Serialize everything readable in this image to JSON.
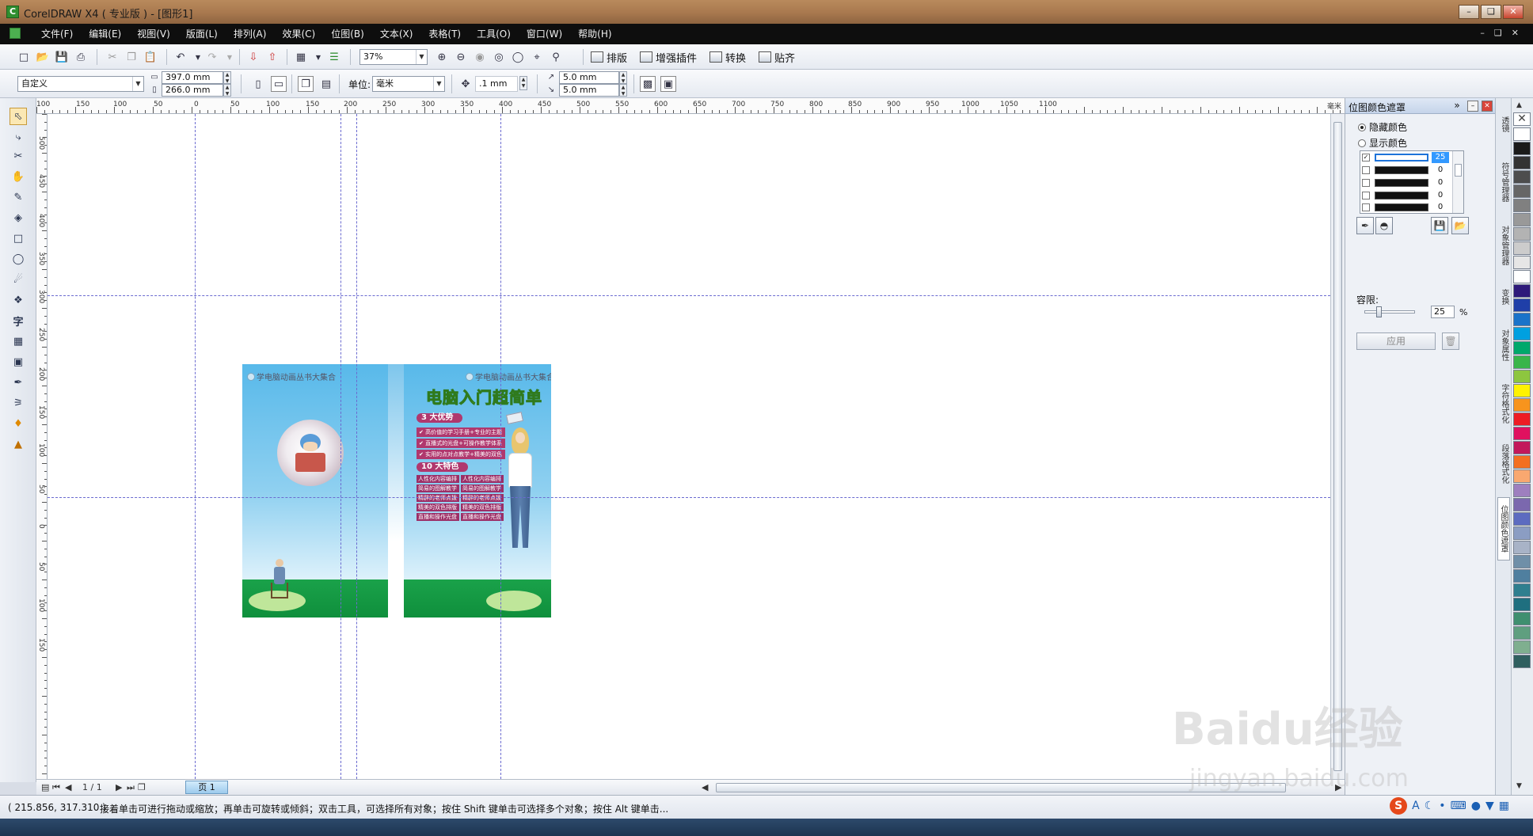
{
  "window": {
    "title": "CorelDRAW X4 ( 专业版 ) - [图形1]",
    "buttons": [
      "–",
      "❑",
      "✕"
    ]
  },
  "menubar": {
    "items": [
      "文件(F)",
      "编辑(E)",
      "视图(V)",
      "版面(L)",
      "排列(A)",
      "效果(C)",
      "位图(B)",
      "文本(X)",
      "表格(T)",
      "工具(O)",
      "窗口(W)",
      "帮助(H)"
    ],
    "doc_buttons": [
      "–",
      "❑",
      "✕"
    ]
  },
  "toolbar1": {
    "zoom": "37%",
    "plugins": [
      "排版",
      "增强插件",
      "转换",
      "贴齐"
    ]
  },
  "toolbar2": {
    "preset": "自定义",
    "width": "397.0 mm",
    "height": "266.0 mm",
    "unit_label": "单位:",
    "unit": "毫米",
    "nudge": ".1 mm",
    "dup_x": "5.0 mm",
    "dup_y": "5.0 mm"
  },
  "rulers": {
    "top_labels": [
      "100",
      "150",
      "100",
      "50",
      "0",
      "50",
      "100",
      "150",
      "200",
      "250",
      "300",
      "350",
      "400",
      "450",
      "500",
      "550",
      "600",
      "650",
      "700",
      "750",
      "800",
      "850",
      "900",
      "950",
      "1000",
      "1050",
      "1100"
    ],
    "left_labels": [
      "500",
      "450",
      "400",
      "350",
      "300",
      "250",
      "200",
      "150",
      "100",
      "50",
      "0",
      "50",
      "100",
      "150"
    ],
    "unit": "毫米"
  },
  "cover": {
    "series": "学电脑动画丛书大集合",
    "title": "电脑入门超简单",
    "advantages_header": "3 大优势",
    "advantages": [
      "高价值的学习手册+专业的主题",
      "直播式的光盘+可操作教学体系",
      "实用的点对点教学+精美的双色"
    ],
    "features_header": "10 大特色",
    "features": [
      "人性化内容编排",
      "人性化内容编排",
      "简易的图解教学",
      "简易的图解教学",
      "精辟的老师点拨",
      "精辟的老师点拨",
      "精美的双色排版",
      "精美的双色排版",
      "直播和操作光盘",
      "直播和操作光盘"
    ]
  },
  "pagenav": {
    "counter": "1 / 1",
    "page_tab": "页 1"
  },
  "docker": {
    "title": "位图颜色遮罩",
    "hide_label": "隐藏颜色",
    "show_label": "显示颜色",
    "colors": [
      {
        "checked": true,
        "value": "25"
      },
      {
        "checked": false,
        "value": "0"
      },
      {
        "checked": false,
        "value": "0"
      },
      {
        "checked": false,
        "value": "0"
      },
      {
        "checked": false,
        "value": "0"
      }
    ],
    "tolerance_label": "容限:",
    "tolerance_value": "25",
    "tolerance_fraction": 0.25,
    "tolerance_unit": "%",
    "apply_label": "应用"
  },
  "docker_tabs": [
    "透镜",
    "符号管理器",
    "对象管理器",
    "变换",
    "对象属性",
    "字符格式化",
    "段落格式化",
    "位图颜色遮罩"
  ],
  "palette": [
    "#ffffff",
    "#1a1a1a",
    "#333333",
    "#4d4d4d",
    "#666666",
    "#808080",
    "#999999",
    "#b3b3b3",
    "#cccccc",
    "#e6e6e6",
    "#ffffff",
    "#2e1a7a",
    "#1f3fa8",
    "#1a73c9",
    "#00a0e0",
    "#00a86b",
    "#39b54a",
    "#8dc63f",
    "#fff200",
    "#f7941d",
    "#ed1c24",
    "#e0115f",
    "#c2185b",
    "#f36f21",
    "#f9a870",
    "#9e7fbf",
    "#7b68ae",
    "#5c6bc0",
    "#8b9dc3",
    "#a8b3c7",
    "#6f8fa8",
    "#4f7f9f",
    "#2f7f8f",
    "#1f6f7f",
    "#3f8f6f",
    "#5f9f7f",
    "#7faf8f",
    "#2f5f5f"
  ],
  "status": {
    "coords": "( 215.856, 317.310 )",
    "hint": "接着单击可进行拖动或缩放；再单击可旋转或倾斜；双击工具，可选择所有对象；按住 Shift 键单击可选择多个对象；按住 Alt 键单击..."
  },
  "watermark": {
    "main": "Baidu经验",
    "sub": "jingyan.baidu.com"
  }
}
